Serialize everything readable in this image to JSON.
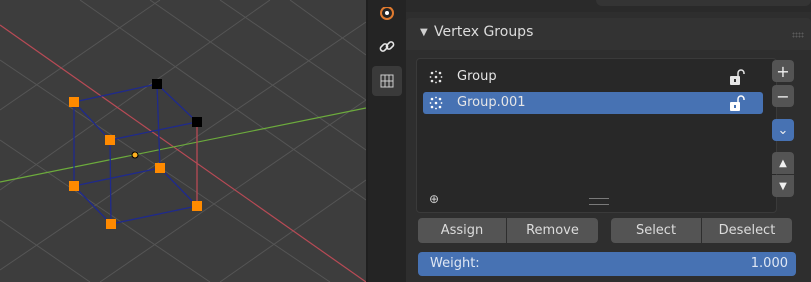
{
  "viewport": {
    "colors": {
      "grid": "#555555",
      "x_axis": "#b74a55",
      "y_axis": "#6cab3c",
      "wire": "#1f2a8c",
      "vertex_selected": "#ff8a00",
      "vertex_unselected": "#000000"
    }
  },
  "tabs": [
    {
      "icon": "physics-icon"
    },
    {
      "icon": "constraint-link-icon"
    },
    {
      "icon": "object-data-icon",
      "active": true
    }
  ],
  "panel": {
    "title": "Vertex Groups",
    "groups": [
      {
        "name": "Group",
        "selected": false,
        "icon": "vertex-group-icon",
        "lock_icon": "lock-open-icon"
      },
      {
        "name": "Group.001",
        "selected": true,
        "icon": "vertex-group-icon",
        "lock_icon": "lock-open-icon"
      }
    ],
    "side_buttons": [
      {
        "label": "+",
        "icon": "plus-icon"
      },
      {
        "label": "−",
        "icon": "minus-icon"
      },
      {
        "label": "⌄",
        "icon": "chevron-down-icon",
        "active": true
      },
      {
        "label": "▲",
        "icon": "move-up-icon"
      },
      {
        "label": "▼",
        "icon": "move-down-icon"
      }
    ],
    "assign": "Assign",
    "remove": "Remove",
    "select": "Select",
    "deselect": "Deselect",
    "weight_label": "Weight:",
    "weight_value": "1.000",
    "accent": "#4772b3"
  }
}
